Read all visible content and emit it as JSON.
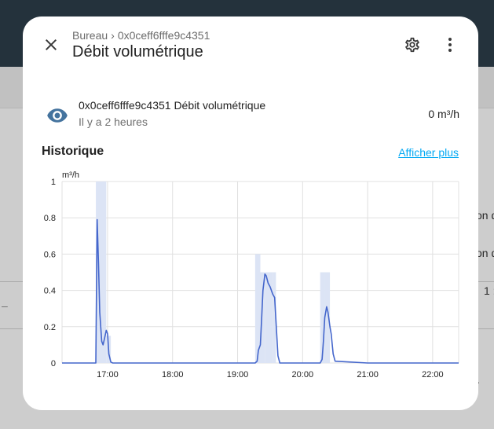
{
  "background": {
    "right_snippets": [
      "on d",
      "on d",
      "1 :"
    ],
    "left_dash": "–",
    "bottom_dot": "."
  },
  "dialog": {
    "breadcrumb": {
      "area": "Bureau",
      "device": "0x0ceff6fffe9c4351"
    },
    "title": "Débit volumétrique",
    "icons": {
      "close": "close-icon",
      "settings": "gear-icon",
      "menu": "dots-vertical-icon",
      "entity": "eye-icon"
    },
    "entity": {
      "name": "0x0ceff6fffe9c4351 Débit volumétrique",
      "last_changed": "Il y a 2 heures",
      "state": "0 m³/h"
    },
    "history": {
      "title": "Historique",
      "show_more": "Afficher plus"
    }
  },
  "colors": {
    "accent": "#03a9f4",
    "series": "#4466cc",
    "band": "#dce4f5"
  },
  "chart_data": {
    "type": "line",
    "ylabel": "m³/h",
    "ylim": [
      0,
      1
    ],
    "yticks": [
      0,
      0.2,
      0.4,
      0.6,
      0.8,
      1
    ],
    "ytick_labels": [
      "0",
      "0.2",
      "0.4",
      "0.6",
      "0.8",
      "1"
    ],
    "xlim": [
      16.3,
      22.4
    ],
    "xticks": [
      17,
      18,
      19,
      20,
      21,
      22
    ],
    "xtick_labels": [
      "17:00",
      "18:00",
      "19:00",
      "20:00",
      "21:00",
      "22:00"
    ],
    "grid": true,
    "series": [
      {
        "x": [
          16.3,
          16.36,
          16.37,
          16.82,
          16.84,
          16.86,
          16.88,
          16.91,
          16.93,
          16.95,
          16.98,
          17.0,
          17.02,
          17.05,
          17.08,
          17.1,
          18.0,
          19.0,
          19.27,
          19.3,
          19.32,
          19.35,
          19.37,
          19.39,
          19.42,
          19.44,
          19.47,
          19.5,
          19.54,
          19.57,
          19.59,
          19.62,
          19.65,
          20.0,
          20.27,
          20.3,
          20.32,
          20.34,
          20.37,
          20.39,
          20.42,
          20.44,
          20.47,
          20.5,
          21.0,
          22.0,
          22.4
        ],
        "values": [
          0,
          0,
          0,
          0,
          0.79,
          0.55,
          0.28,
          0.12,
          0.1,
          0.13,
          0.18,
          0.16,
          0.05,
          0.005,
          0,
          0,
          0,
          0,
          0,
          0.01,
          0.07,
          0.1,
          0.25,
          0.4,
          0.49,
          0.48,
          0.44,
          0.42,
          0.38,
          0.36,
          0.23,
          0.04,
          0,
          0,
          0,
          0.02,
          0.12,
          0.25,
          0.31,
          0.28,
          0.2,
          0.16,
          0.05,
          0.01,
          0,
          0,
          0
        ]
      }
    ],
    "band": [
      {
        "x0": 16.82,
        "x1": 16.98,
        "top": 1
      },
      {
        "x0": 16.98,
        "x1": 17.05,
        "top": 0.15
      },
      {
        "x0": 19.27,
        "x1": 19.35,
        "top": 0.6
      },
      {
        "x0": 19.35,
        "x1": 19.42,
        "top": 0.5
      },
      {
        "x0": 19.42,
        "x1": 19.54,
        "top": 0.5
      },
      {
        "x0": 19.54,
        "x1": 19.59,
        "top": 0.5
      },
      {
        "x0": 20.27,
        "x1": 20.34,
        "top": 0.5
      },
      {
        "x0": 20.34,
        "x1": 20.42,
        "top": 0.5
      }
    ]
  }
}
